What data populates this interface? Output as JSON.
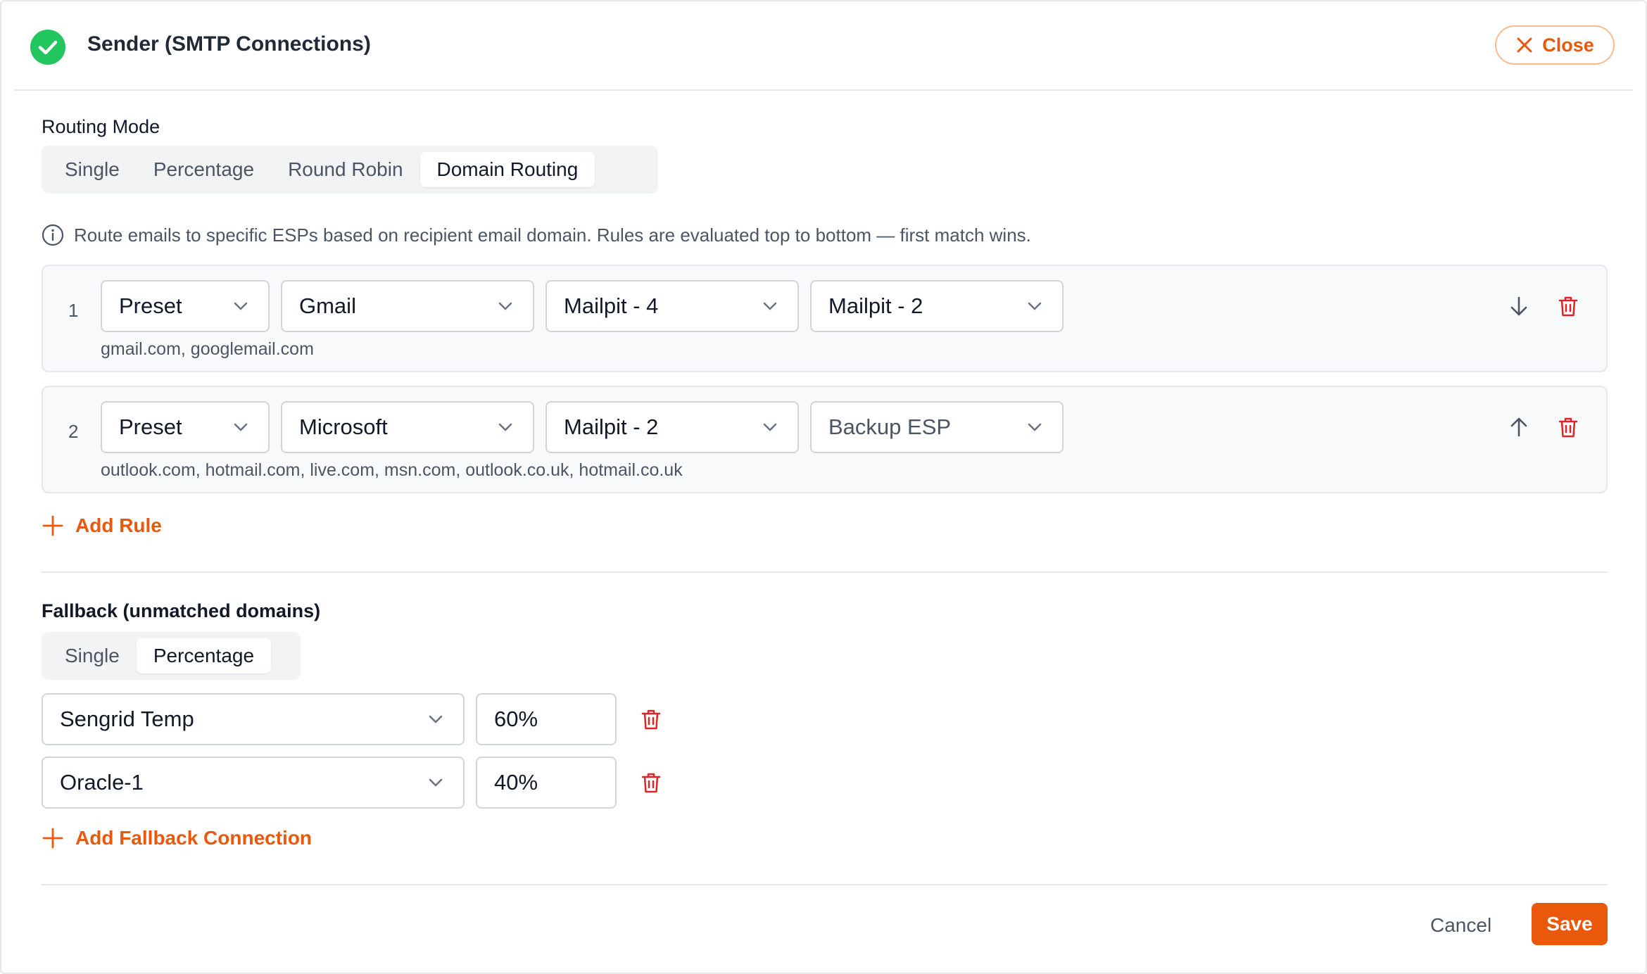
{
  "header": {
    "title": "Sender (SMTP Connections)",
    "close_label": "Close"
  },
  "routing_mode": {
    "label": "Routing Mode",
    "options": [
      "Single",
      "Percentage",
      "Round Robin",
      "Domain Routing"
    ],
    "selected": "Domain Routing"
  },
  "info_text": "Route emails to specific ESPs based on recipient email domain. Rules are evaluated top to bottom — first match wins.",
  "rules": [
    {
      "number": "1",
      "type": "Preset",
      "provider": "Gmail",
      "primary": "Mailpit - 4",
      "secondary": "Mailpit - 2",
      "domains": "gmail.com, googlemail.com",
      "move": "down"
    },
    {
      "number": "2",
      "type": "Preset",
      "provider": "Microsoft",
      "primary": "Mailpit - 2",
      "secondary": "Backup ESP",
      "domains": "outlook.com, hotmail.com, live.com, msn.com, outlook.co.uk, hotmail.co.uk",
      "move": "up"
    }
  ],
  "add_rule_label": "Add Rule",
  "fallback": {
    "label": "Fallback (unmatched domains)",
    "options": [
      "Single",
      "Percentage"
    ],
    "selected": "Percentage",
    "connections": [
      {
        "name": "Sengrid Temp",
        "percent": "60%"
      },
      {
        "name": "Oracle-1",
        "percent": "40%"
      }
    ],
    "add_label": "Add Fallback Connection"
  },
  "footer": {
    "cancel_label": "Cancel",
    "save_label": "Save"
  },
  "colors": {
    "accent": "#ea580c",
    "success": "#22c55e",
    "danger": "#dc2626"
  }
}
